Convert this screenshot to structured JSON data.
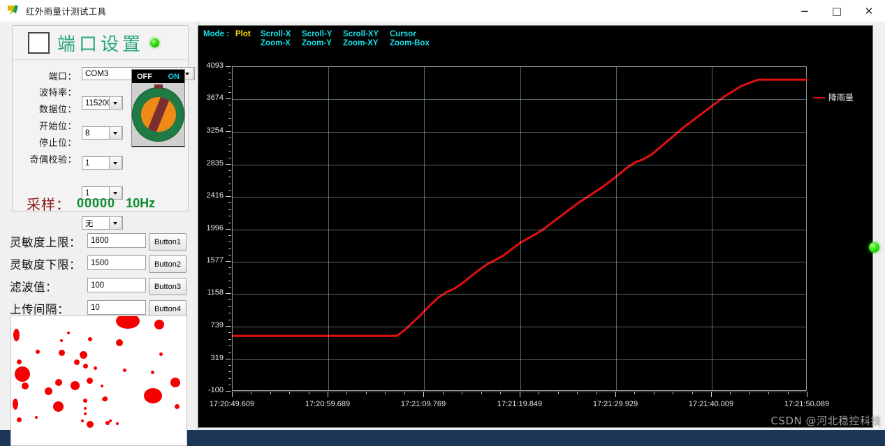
{
  "window": {
    "title": "红外雨量计测试工具",
    "icon": "app-icon",
    "minimize": "−",
    "maximize": "□",
    "close": "✕"
  },
  "port_settings": {
    "title": "端口设置",
    "checkbox_checked": false,
    "led_color": "#2ed60f",
    "fields": [
      {
        "label": "端口：",
        "value": "COM3"
      },
      {
        "label": "波特率：",
        "value": "115200"
      },
      {
        "label": "数据位：",
        "value": "8"
      },
      {
        "label": "开始位：",
        "value": "1"
      },
      {
        "label": "停止位：",
        "value": "1"
      },
      {
        "label": "奇偶校验：",
        "value": "无"
      }
    ],
    "switch": {
      "off_label": "OFF",
      "on_label": "ON",
      "state": "ON"
    },
    "sampling": {
      "label": "采样：",
      "count": "00000",
      "rate": "10Hz"
    }
  },
  "parameters": [
    {
      "label": "灵敏度上限：",
      "value": "1800",
      "button": "Button1"
    },
    {
      "label": "灵敏度下限：",
      "value": "1500",
      "button": "Button2"
    },
    {
      "label": "滤波值：",
      "value": "100",
      "button": "Button3"
    },
    {
      "label": "上传间隔：",
      "value": "10",
      "button": "Button4"
    }
  ],
  "rain_view": {
    "name": "rain-droplet-preview",
    "background": "#ffffff",
    "drop_color": "#f50000"
  },
  "chart_menu": {
    "mode_label": "Mode :",
    "mode_value": "Plot",
    "columns": [
      {
        "top": "Scroll-X",
        "bottom": "Zoom-X"
      },
      {
        "top": "Scroll-Y",
        "bottom": "Zoom-Y"
      },
      {
        "top": "Scroll-XY",
        "bottom": "Zoom-XY"
      },
      {
        "top": "Cursor",
        "bottom": "Zoom-Box"
      }
    ]
  },
  "chart_data": {
    "type": "line",
    "title": "",
    "xlabel": "",
    "ylabel": "",
    "legend": [
      "降雨量"
    ],
    "legend_position": "right",
    "grid": true,
    "series_color": "#e11010",
    "background": "#000000",
    "ylim": [
      -100,
      4093
    ],
    "yticks": [
      4093,
      3674,
      3254,
      2835,
      2416,
      1996,
      1577,
      1158,
      739,
      319,
      -100
    ],
    "xticks": [
      "17:20:49.609",
      "17:20:59.689",
      "17:21:09.769",
      "17:21:19.849",
      "17:21:29.929",
      "17:21:40.009",
      "17:21:50.089"
    ],
    "xlim": [
      "17:20:49.609",
      "17:21:50.089"
    ],
    "series": [
      {
        "name": "降雨量",
        "x": [
          0,
          2,
          4,
          6,
          8,
          10,
          12,
          14,
          16,
          18,
          20,
          21,
          22,
          23,
          24,
          25,
          26,
          27,
          28,
          29,
          30,
          31,
          32,
          33,
          34,
          35,
          36,
          37,
          38,
          39,
          40,
          41,
          42,
          43,
          44,
          45,
          46,
          47,
          48,
          49,
          50,
          51,
          52,
          53,
          54,
          55,
          56,
          57,
          58,
          59,
          60,
          62,
          64,
          66,
          68,
          70
        ],
        "y": [
          620,
          620,
          620,
          620,
          620,
          620,
          620,
          620,
          620,
          620,
          620,
          700,
          800,
          900,
          1010,
          1110,
          1180,
          1230,
          1300,
          1390,
          1470,
          1545,
          1600,
          1660,
          1740,
          1820,
          1880,
          1940,
          2010,
          2090,
          2170,
          2250,
          2330,
          2400,
          2470,
          2540,
          2620,
          2700,
          2790,
          2860,
          2900,
          2960,
          3050,
          3140,
          3230,
          3320,
          3400,
          3480,
          3560,
          3640,
          3720,
          3850,
          3930,
          3930,
          3930,
          3930
        ]
      }
    ]
  },
  "watermark": "CSDN @河北稳控科技"
}
